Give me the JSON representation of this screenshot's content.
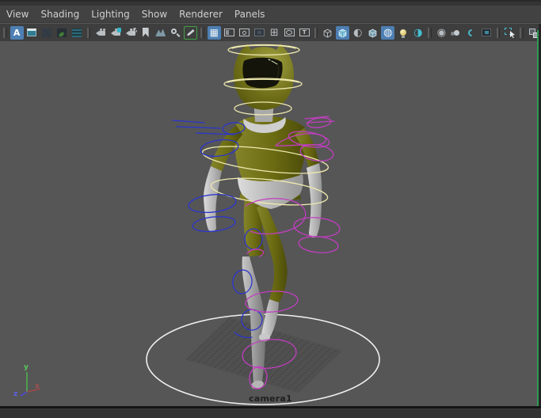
{
  "menu_bar": {
    "items": [
      {
        "label": "View"
      },
      {
        "label": "Shading"
      },
      {
        "label": "Lighting"
      },
      {
        "label": "Show"
      },
      {
        "label": "Renderer"
      },
      {
        "label": "Panels"
      }
    ]
  },
  "toolbar": {
    "items": [
      {
        "name": "letter-a",
        "title": "A",
        "glyph": "A",
        "active": true
      },
      {
        "name": "pane-view",
        "title": "Pane View",
        "active": false
      },
      {
        "name": "dark-texture",
        "title": "Dark Texture",
        "active": false
      },
      {
        "name": "paint-texture",
        "title": "Paint Texture",
        "active": false
      },
      {
        "name": "striped-texture",
        "title": "Striped Texture",
        "active": false
      },
      {
        "name": "select-camera",
        "title": "Select Camera",
        "active": false
      },
      {
        "name": "lock-camera",
        "title": "Lock Camera",
        "active": false
      },
      {
        "name": "camera-attributes",
        "title": "Camera Attributes",
        "active": false
      },
      {
        "name": "bookmarks",
        "title": "Bookmarks",
        "active": false
      },
      {
        "name": "image-plane",
        "title": "Image Plane",
        "active": false
      },
      {
        "name": "pan-zoom",
        "title": "2D Pan/Zoom",
        "active": false
      },
      {
        "name": "grease-pencil",
        "title": "Grease Pencil",
        "active": true
      },
      {
        "name": "grid",
        "title": "Grid",
        "glyph": "▦",
        "active": true
      },
      {
        "name": "film-gate",
        "title": "Film Gate",
        "active": false
      },
      {
        "name": "resolution-gate",
        "title": "Resolution Gate",
        "active": false
      },
      {
        "name": "gate-mask",
        "title": "Gate Mask",
        "active": false
      },
      {
        "name": "field-chart",
        "title": "Field Chart",
        "glyph": "⊞",
        "active": false
      },
      {
        "name": "safe-action",
        "title": "Safe Action",
        "active": false
      },
      {
        "name": "safe-title",
        "title": "Safe Title",
        "glyph": "T",
        "active": false
      },
      {
        "name": "wireframe",
        "title": "Wireframe",
        "active": false
      },
      {
        "name": "smooth-shade-all",
        "title": "Smooth Shade All",
        "active": true
      },
      {
        "name": "use-default-material",
        "title": "Use Default Material",
        "glyph": "◐",
        "active": false
      },
      {
        "name": "wireframe-on-shaded",
        "title": "Wireframe on Shaded",
        "active": false
      },
      {
        "name": "textured",
        "title": "Textured",
        "glyph": "◍",
        "active": true
      },
      {
        "name": "use-all-lights",
        "title": "Use All Lights",
        "active": false
      },
      {
        "name": "shadows",
        "title": "Shadows",
        "glyph": "◑",
        "active": false
      },
      {
        "name": "ssao",
        "title": "Screen-space Ambient Occlusion",
        "glyph": "◉",
        "active": false
      },
      {
        "name": "motion-blur",
        "title": "Motion Blur",
        "active": false
      },
      {
        "name": "multisample-aa",
        "title": "Multisample Anti-aliasing",
        "active": false
      },
      {
        "name": "depth-of-field",
        "title": "Depth of Field",
        "active": false
      },
      {
        "name": "isolate-select",
        "title": "Isolate Select",
        "active": false
      },
      {
        "name": "x-ray",
        "title": "X-Ray",
        "active": false
      }
    ]
  },
  "viewport": {
    "camera_label": "camera1",
    "axis_gizmo": {
      "x": "x",
      "y": "y",
      "z": "z"
    },
    "colors": {
      "viewport_background": "#565656",
      "control_yellow": "#efe9ae",
      "control_blue": "#2b35cf",
      "control_magenta": "#c13ec1",
      "ground_circle_white": "#efefef",
      "character_suit_olive": "#6b6b12",
      "character_trim_white": "#c4c4c4",
      "active_button_blue": "#4d7fb3",
      "grease_pencil_green": "#43a047",
      "panel_edge_green": "#2f9a55",
      "axis_x_red": "#a04848",
      "axis_y_green": "#4db04d",
      "axis_z_blue": "#4a4ae0"
    }
  }
}
